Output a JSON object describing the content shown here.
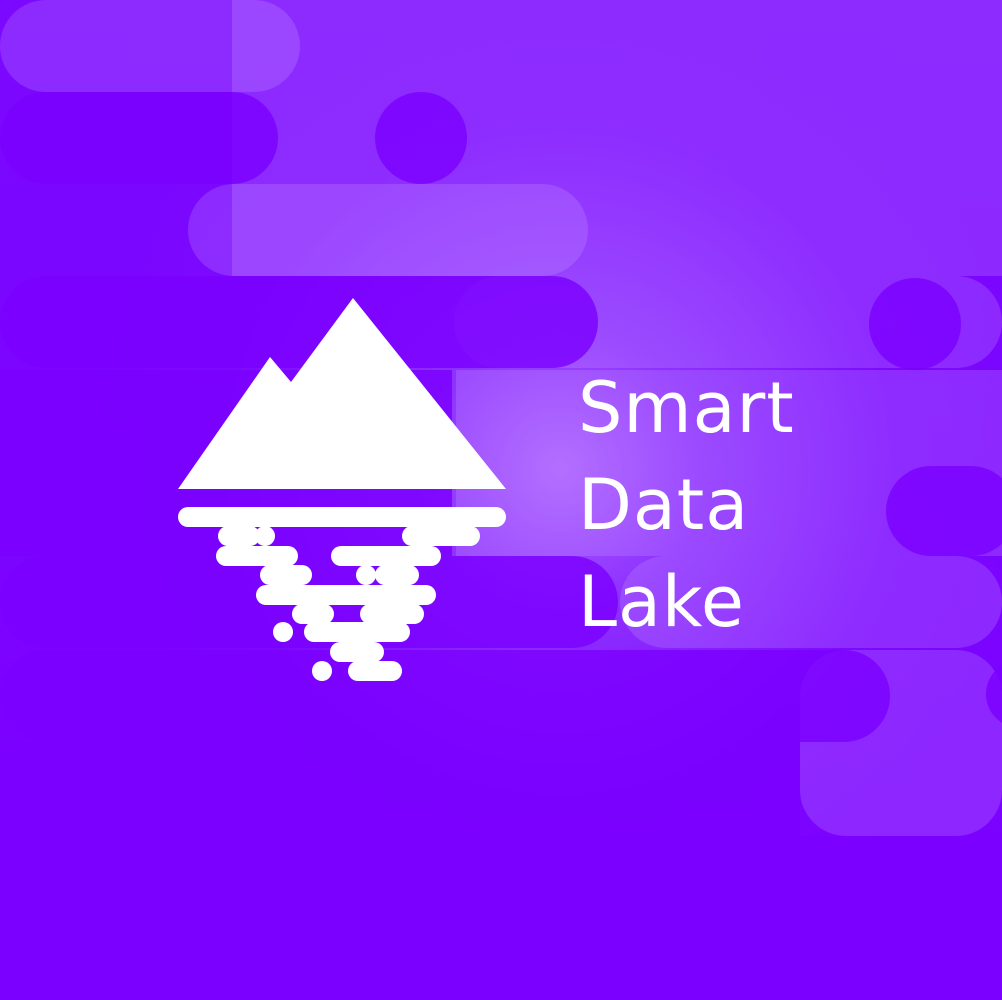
{
  "brand": {
    "line1": "Smart",
    "line2": "Data",
    "line3": "Lake"
  },
  "colors": {
    "primary_purple": "#7b00ff",
    "highlight_purple": "#b069ff",
    "white": "#ffffff"
  },
  "icons": {
    "logo": "mountain-lake-icon"
  }
}
